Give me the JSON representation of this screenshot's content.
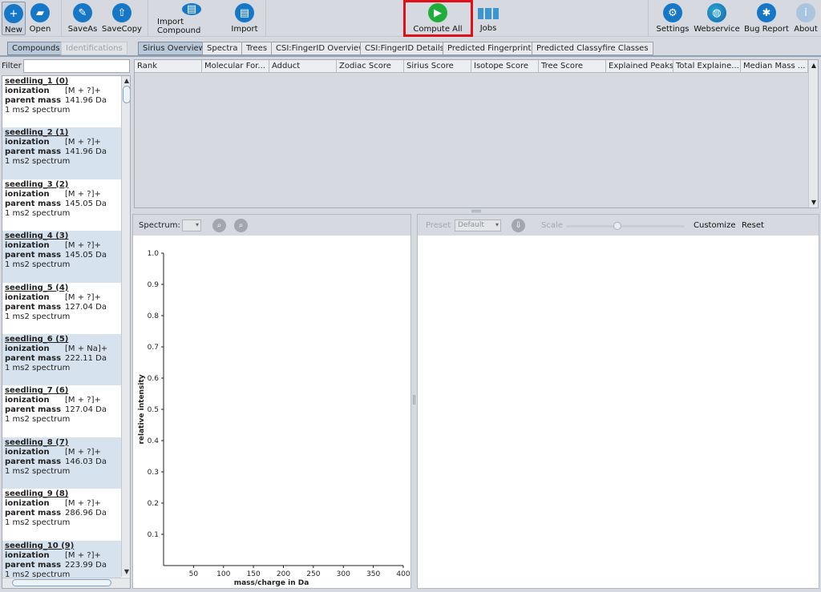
{
  "toolbar": {
    "new": "New",
    "open": "Open",
    "save_as": "SaveAs",
    "save_copy": "SaveCopy",
    "import_compound": "Import Compound",
    "import": "Import",
    "compute_all": "Compute All",
    "jobs": "Jobs",
    "settings": "Settings",
    "webservice": "Webservice",
    "bug_report": "Bug Report",
    "about": "About"
  },
  "left_tabs": {
    "compounds": "Compounds",
    "identifications": "Identifications"
  },
  "main_tabs": [
    "Sirius Overview",
    "Spectra",
    "Trees",
    "CSI:FingerID Overview",
    "CSI:FingerID Details",
    "Predicted Fingerprint",
    "Predicted Classyfire Classes"
  ],
  "filter": {
    "label": "Filter",
    "value": ""
  },
  "compound_fields": {
    "ionization": "ionization",
    "parent_mass": "parent mass"
  },
  "compounds": [
    {
      "name": "seedling_1 (0)",
      "ionization": "[M + ?]+",
      "mass": "141.96 Da",
      "spectra": "1 ms2 spectrum"
    },
    {
      "name": "seedling_2 (1)",
      "ionization": "[M + ?]+",
      "mass": "141.96 Da",
      "spectra": "1 ms2 spectrum"
    },
    {
      "name": "seedling_3 (2)",
      "ionization": "[M + ?]+",
      "mass": "145.05 Da",
      "spectra": "1 ms2 spectrum"
    },
    {
      "name": "seedling_4 (3)",
      "ionization": "[M + ?]+",
      "mass": "145.05 Da",
      "spectra": "1 ms2 spectrum"
    },
    {
      "name": "seedling_5 (4)",
      "ionization": "[M + ?]+",
      "mass": "127.04 Da",
      "spectra": "1 ms2 spectrum"
    },
    {
      "name": "seedling_6 (5)",
      "ionization": "[M + Na]+",
      "mass": "222.11 Da",
      "spectra": "1 ms2 spectrum"
    },
    {
      "name": "seedling_7 (6)",
      "ionization": "[M + ?]+",
      "mass": "127.04 Da",
      "spectra": "1 ms2 spectrum"
    },
    {
      "name": "seedling_8 (7)",
      "ionization": "[M + ?]+",
      "mass": "146.03 Da",
      "spectra": "1 ms2 spectrum"
    },
    {
      "name": "seedling_9 (8)",
      "ionization": "[M + ?]+",
      "mass": "286.96 Da",
      "spectra": "1 ms2 spectrum"
    },
    {
      "name": "seedling_10 (9)",
      "ionization": "[M + ?]+",
      "mass": "223.99 Da",
      "spectra": "1 ms2 spectrum"
    }
  ],
  "table_columns": [
    "Rank",
    "Molecular For...",
    "Adduct",
    "Zodiac Score",
    "Sirius Score",
    "Isotope Score",
    "Tree Score",
    "Explained Peaks",
    "Total Explaine...",
    "Median Mass ..."
  ],
  "spectrum": {
    "label": "Spectrum:",
    "combo_value": ""
  },
  "tree_toolbar": {
    "preset_label": "Preset",
    "preset_value": "Default",
    "scale_label": "Scale",
    "scale_level": 0.43,
    "customize": "Customize",
    "reset": "Reset"
  },
  "chart_data": {
    "type": "scatter",
    "xlabel": "mass/charge in Da",
    "ylabel": "relative intensity",
    "x_ticks": [
      50,
      100,
      150,
      200,
      250,
      300,
      350,
      400
    ],
    "y_ticks": [
      0.1,
      0.2,
      0.3,
      0.4,
      0.5,
      0.6,
      0.7,
      0.8,
      0.9,
      1.0
    ],
    "xlim": [
      0,
      400
    ],
    "ylim": [
      0,
      1.0
    ],
    "series": []
  },
  "colors": {
    "accent_blue": "#1677c6",
    "compute_green": "#1fae3c",
    "highlight_red": "#e0101a",
    "alt_row": "#d6e2ee"
  }
}
